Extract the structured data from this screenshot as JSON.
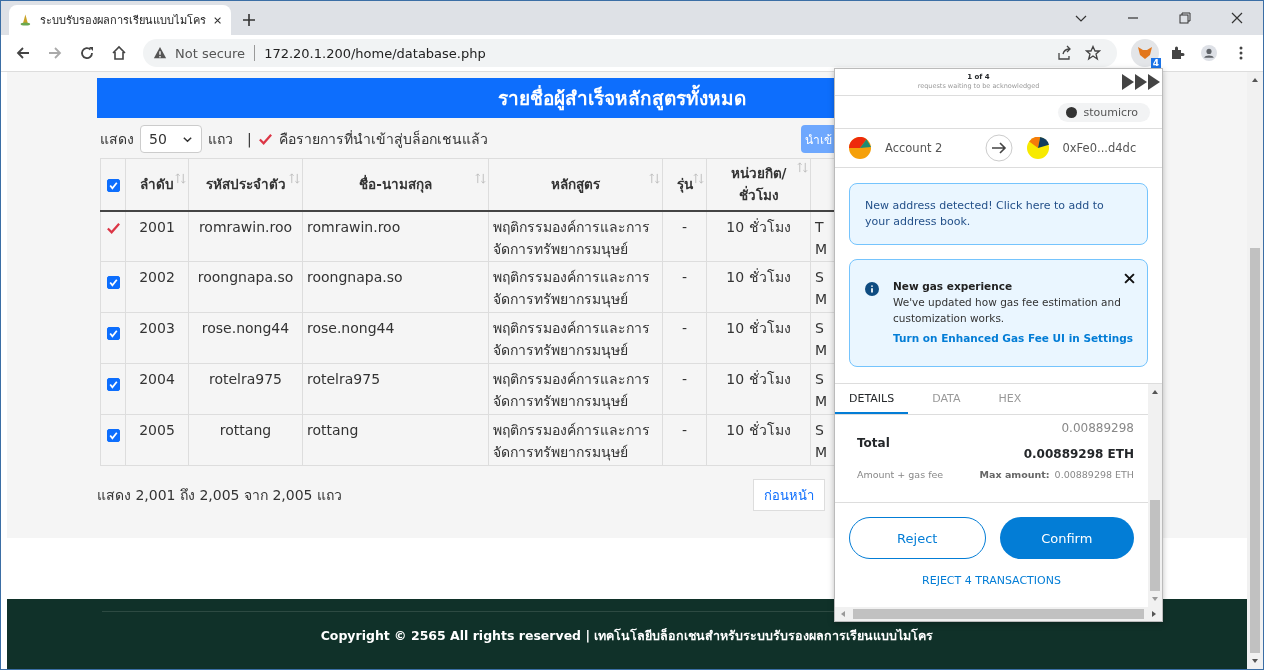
{
  "browser": {
    "tab_title": "ระบบรับรองผลการเรียนแบบไมโคร",
    "url_security": "Not secure",
    "url": "172.20.1.200/home/database.php",
    "extension_badge": "4"
  },
  "page": {
    "heading": "รายชื่อผู้สำเร็จหลักสูตรทั้งหมด",
    "show_label": "แสดง",
    "page_size": "50",
    "rows_label": "แถว",
    "separator": "|",
    "legend": "คือรายการที่นำเข้าสู่บล็อกเชนแล้ว",
    "import_button": "นำเข้",
    "select_all_checked": true,
    "columns": [
      {
        "lines": [
          "ลำดับ"
        ]
      },
      {
        "lines": [
          "รหัสประจำตัว"
        ]
      },
      {
        "lines": [
          "ชื่อ-นามสกุล"
        ]
      },
      {
        "lines": [
          "หลักสูตร"
        ]
      },
      {
        "lines": [
          "รุ่น"
        ]
      },
      {
        "lines": [
          "หน่วยกิต/",
          "ชั่วโมง"
        ]
      }
    ],
    "rows": [
      {
        "kind": "imported",
        "no": "2001",
        "id": "romrawin.roo",
        "name": "romrawin.roo",
        "course": [
          "พฤติกรรมองค์การและการ",
          "จัดการทรัพยากรมนุษย์"
        ],
        "batch": "-",
        "hours": "10 ชั่วโมง",
        "column_7": [
          "T",
          "M"
        ]
      },
      {
        "kind": "checkbox",
        "checked": true,
        "no": "2002",
        "id": "roongnapa.so",
        "name": "roongnapa.so",
        "course": [
          "พฤติกรรมองค์การและการ",
          "จัดการทรัพยากรมนุษย์"
        ],
        "batch": "-",
        "hours": "10 ชั่วโมง",
        "column_7": [
          "S",
          "M"
        ]
      },
      {
        "kind": "checkbox",
        "checked": true,
        "no": "2003",
        "id": "rose.nong44",
        "name": "rose.nong44",
        "course": [
          "พฤติกรรมองค์การและการ",
          "จัดการทรัพยากรมนุษย์"
        ],
        "batch": "-",
        "hours": "10 ชั่วโมง",
        "column_7": [
          "S",
          "M"
        ]
      },
      {
        "kind": "checkbox",
        "checked": true,
        "no": "2004",
        "id": "rotelra975",
        "name": "rotelra975",
        "course": [
          "พฤติกรรมองค์การและการ",
          "จัดการทรัพยากรมนุษย์"
        ],
        "batch": "-",
        "hours": "10 ชั่วโมง",
        "column_7": [
          "S",
          "M"
        ]
      },
      {
        "kind": "checkbox",
        "checked": true,
        "no": "2005",
        "id": "rottang",
        "name": "rottang",
        "course": [
          "พฤติกรรมองค์การและการ",
          "จัดการทรัพยากรมนุษย์"
        ],
        "batch": "-",
        "hours": "10 ชั่วโมง",
        "column_7": [
          "S",
          "M"
        ]
      }
    ],
    "summary": "แสดง 2,001 ถึง 2,005 จาก 2,005 แถว",
    "prev_button": "ก่อนหน้า",
    "footer": "Copyright © 2565 All rights reserved | เทคโนโลยีบล็อกเชนสำหรับระบบรับรองผลการเรียนแบบไมโคร"
  },
  "popup": {
    "queue_count": "1 of 4",
    "queue_note": "requests waiting to be acknowledged",
    "site": "stoumicro",
    "from_account": "Account 2",
    "to_address": "0xFe0...d4dc",
    "notice": "New address detected! Click here to add to your address book.",
    "gas_title": "New gas experience",
    "gas_text": "We've updated how gas fee estimation and customization works.",
    "gas_link": "Turn on Enhanced Gas Fee UI in Settings",
    "tabs": [
      {
        "label": "DETAILS",
        "selected": true
      },
      {
        "label": "DATA",
        "selected": false
      },
      {
        "label": "HEX",
        "selected": false
      }
    ],
    "amount": "0.00889298",
    "total_label": "Total",
    "total_value": "0.00889298 ETH",
    "total_note": "Amount + gas fee",
    "max_label": "Max amount:",
    "max_value": "0.00889298 ETH",
    "reject": "Reject",
    "confirm": "Confirm",
    "reject_all": "REJECT 4 TRANSACTIONS"
  }
}
